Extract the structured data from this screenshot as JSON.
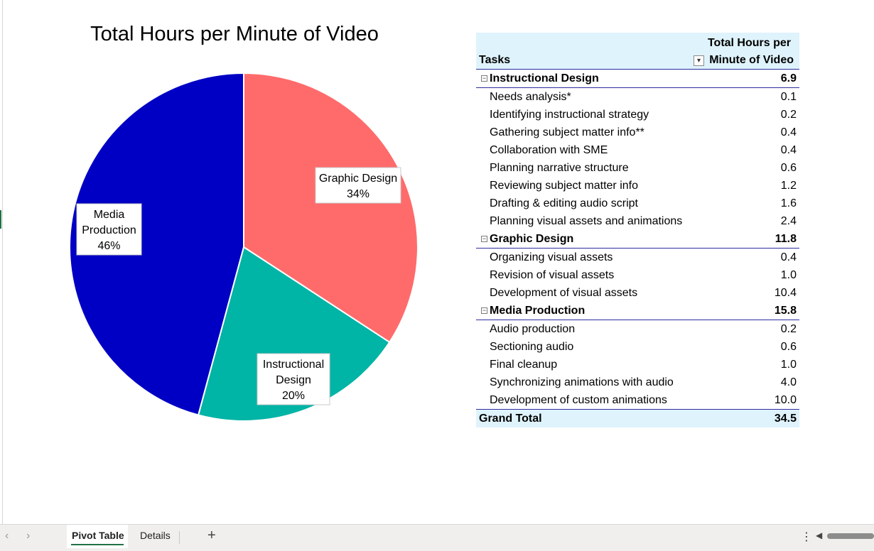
{
  "chart_data": {
    "type": "pie",
    "title": "Total Hours per Minute of Video",
    "categories": [
      "Graphic Design",
      "Instructional Design",
      "Media Production"
    ],
    "values": [
      11.8,
      6.9,
      15.8
    ],
    "labels": [
      "34%",
      "20%",
      "46%"
    ],
    "colors": [
      "#ff6b6b",
      "#00b4a6",
      "#0000c4"
    ],
    "legend": "none"
  },
  "pivot": {
    "header_tasks": "Tasks",
    "header_value_line1": "Total Hours per",
    "header_value_line2": "Minute of Video",
    "groups": [
      {
        "name": "Instructional Design",
        "total": "6.9",
        "items": [
          {
            "label": "Needs analysis*",
            "value": "0.1"
          },
          {
            "label": "Identifying instructional strategy",
            "value": "0.2"
          },
          {
            "label": "Gathering subject matter info**",
            "value": "0.4"
          },
          {
            "label": "Collaboration with SME",
            "value": "0.4"
          },
          {
            "label": "Planning narrative structure",
            "value": "0.6"
          },
          {
            "label": "Reviewing subject matter info",
            "value": "1.2"
          },
          {
            "label": "Drafting & editing audio script",
            "value": "1.6"
          },
          {
            "label": "Planning visual assets and animations",
            "value": "2.4"
          }
        ]
      },
      {
        "name": "Graphic Design",
        "total": "11.8",
        "items": [
          {
            "label": "Organizing visual assets",
            "value": "0.4"
          },
          {
            "label": "Revision of visual assets",
            "value": "1.0"
          },
          {
            "label": "Development of visual assets",
            "value": "10.4"
          }
        ]
      },
      {
        "name": "Media Production",
        "total": "15.8",
        "items": [
          {
            "label": "Audio production",
            "value": "0.2"
          },
          {
            "label": "Sectioning audio",
            "value": "0.6"
          },
          {
            "label": "Final cleanup",
            "value": "1.0"
          },
          {
            "label": "Synchronizing animations with audio",
            "value": "4.0"
          },
          {
            "label": "Development of custom animations",
            "value": "10.0"
          }
        ]
      }
    ],
    "grand_total_label": "Grand Total",
    "grand_total_value": "34.5"
  },
  "sheet_tabs": {
    "tabs": [
      "Pivot Table",
      "Details"
    ],
    "active": "Pivot Table"
  },
  "icons": {
    "prev": "chevron-left-icon",
    "next": "chevron-right-icon",
    "add": "plus-icon",
    "more": "more-vertical-icon",
    "filter": "sort-filter-icon",
    "collapse": "collapse-minus-icon"
  }
}
